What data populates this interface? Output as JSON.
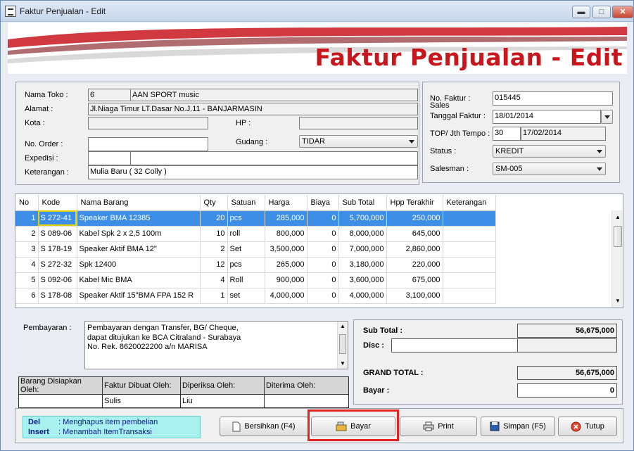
{
  "window": {
    "title": "Faktur Penjualan - Edit",
    "min": "▬",
    "max": "□",
    "close": "✕"
  },
  "banner": {
    "title": "Faktur Penjualan - Edit"
  },
  "customer": {
    "nama_toko_label": "Nama Toko :",
    "nama_toko_code": "6",
    "nama_toko": "AAN SPORT music",
    "alamat_label": "Alamat :",
    "alamat": "Jl.Niaga Timur LT.Dasar No.J.11 - BANJARMASIN",
    "kota_label": "Kota :",
    "kota": "",
    "hp_label": "HP :",
    "hp": "",
    "no_order_label": "No. Order :",
    "no_order": "",
    "gudang_label": "Gudang :",
    "gudang": "TIDAR",
    "expedisi_label": "Expedisi :",
    "expedisi_code": "",
    "expedisi": "",
    "keterangan_label": "Keterangan :",
    "keterangan": "Mulia Baru ( 32 Colly )"
  },
  "invoice": {
    "no_faktur_label": "No. Faktur :",
    "sales_label": "Sales",
    "no_faktur": "015445",
    "tanggal_label": "Tanggal Faktur :",
    "tanggal": "18/01/2014",
    "top_label": "TOP/ Jth Tempo :",
    "top": "30",
    "jatuh_tempo": "17/02/2014",
    "status_label": "Status :",
    "status": "KREDIT",
    "salesman_label": "Salesman :",
    "salesman": "SM-005"
  },
  "grid": {
    "headers": [
      "No",
      "Kode",
      "Nama Barang",
      "Qty",
      "Satuan",
      "Harga",
      "Biaya",
      "Sub Total",
      "Hpp Terakhir",
      "Keterangan"
    ],
    "rows": [
      [
        "1",
        "S 272-41",
        "Speaker BMA 12385",
        "20",
        "pcs",
        "285,000",
        "0",
        "5,700,000",
        "250,000",
        ""
      ],
      [
        "2",
        "S 089-06",
        "Kabel Spk 2 x 2,5 100m",
        "10",
        "roll",
        "800,000",
        "0",
        "8,000,000",
        "645,000",
        ""
      ],
      [
        "3",
        "S 178-19",
        "Speaker Aktif BMA 12\"",
        "2",
        "Set",
        "3,500,000",
        "0",
        "7,000,000",
        "2,860,000",
        ""
      ],
      [
        "4",
        "S 272-32",
        "Spk 12400",
        "12",
        "pcs",
        "265,000",
        "0",
        "3,180,000",
        "220,000",
        ""
      ],
      [
        "5",
        "S 092-06",
        "Kabel Mic BMA",
        "4",
        "Roll",
        "900,000",
        "0",
        "3,600,000",
        "675,000",
        ""
      ],
      [
        "6",
        "S 178-08",
        "Speaker Aktif 15\"BMA FPA 152 R",
        "1",
        "set",
        "4,000,000",
        "0",
        "4,000,000",
        "3,100,000",
        ""
      ]
    ]
  },
  "payment": {
    "label": "Pembayaran :",
    "lines": [
      "Pembayaran dengan Transfer, BG/ Cheque,",
      "dapat ditujukan ke BCA Citraland - Surabaya",
      "No. Rek. 8620022200 a/n MARISA"
    ]
  },
  "signatures": {
    "headers": [
      "Barang Disiapkan Oleh:",
      "Faktur Dibuat Oleh:",
      "Diperiksa Oleh:",
      "Diterima Oleh:"
    ],
    "values": [
      "",
      "Sulis",
      "Liu",
      ""
    ]
  },
  "totals": {
    "sub_total_label": "Sub Total :",
    "sub_total": "56,675,000",
    "disc_label": "Disc :",
    "disc": "",
    "disc_amount": "",
    "grand_total_label": "GRAND TOTAL :",
    "grand_total": "56,675,000",
    "bayar_label": "Bayar :",
    "bayar": "0"
  },
  "hints": {
    "del_key": "Del",
    "del_text": ": Menghapus item pembelian",
    "insert_key": "Insert",
    "insert_text": ": Menambah ItemTransaksi"
  },
  "buttons": {
    "bersihkan": "Bersihkan (F4)",
    "bayar": "Bayar",
    "print": "Print",
    "simpan": "Simpan (F5)",
    "tutup": "Tutup"
  },
  "colors": {
    "accent": "#c8161d",
    "selection": "#3d8ee6",
    "highlight_box": "#e32222",
    "hint_bg": "#a8f1ef"
  }
}
